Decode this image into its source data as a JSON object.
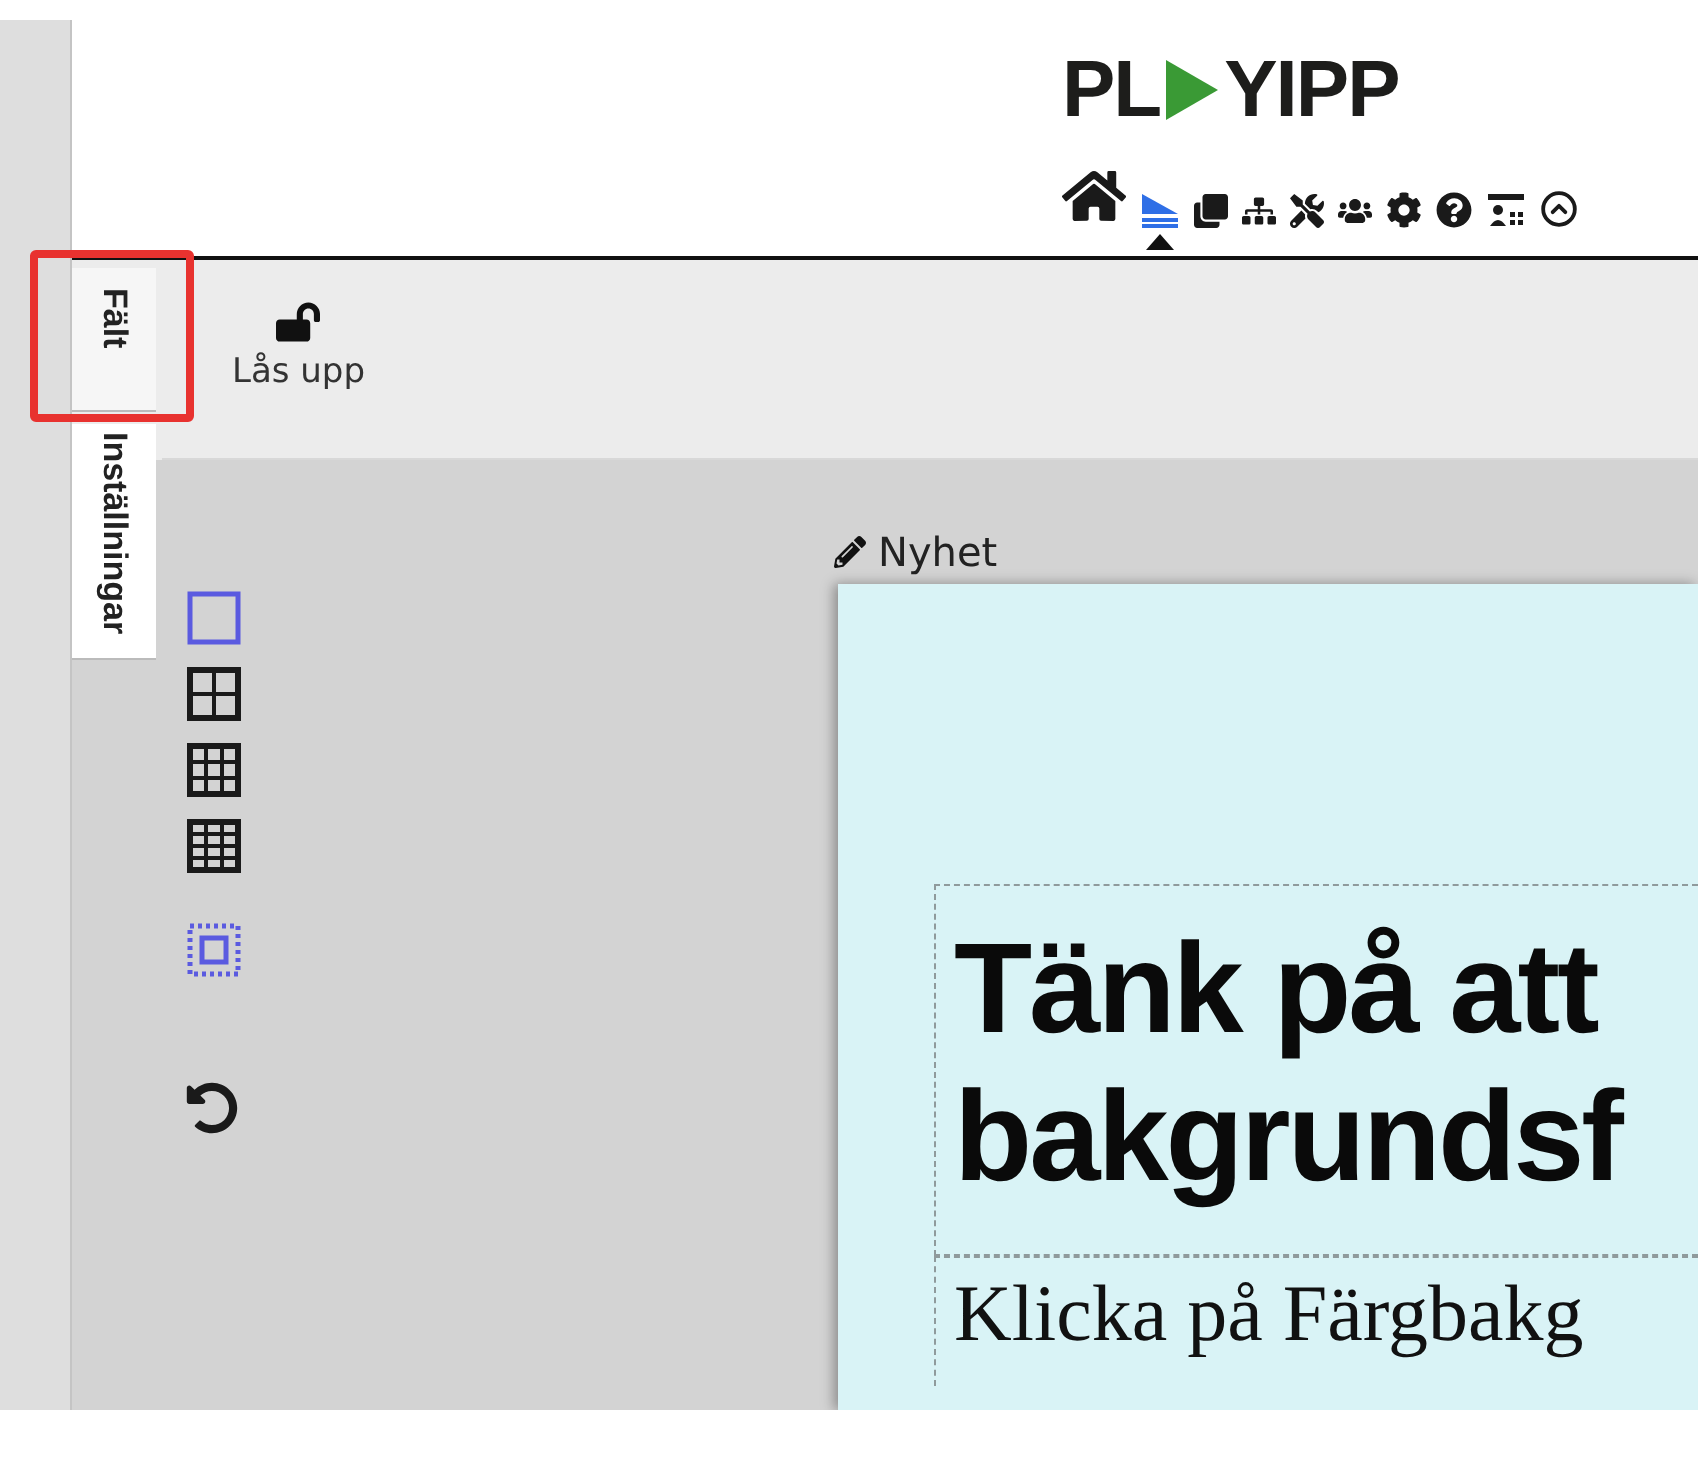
{
  "logo": {
    "left": "PL",
    "right": "YIPP"
  },
  "nav_items": [
    {
      "selected": false
    },
    {
      "selected": true
    },
    {
      "selected": false
    },
    {
      "selected": false
    },
    {
      "selected": false
    },
    {
      "selected": false
    },
    {
      "selected": false
    },
    {
      "selected": false
    },
    {
      "selected": false
    },
    {
      "selected": false
    }
  ],
  "side_tabs": [
    {
      "label": "Fält"
    },
    {
      "label": "Inställningar"
    }
  ],
  "toolbar": {
    "unlock_button": "Lås upp"
  },
  "layout_options": [
    {
      "selected": true
    },
    {
      "selected": false
    },
    {
      "selected": false
    },
    {
      "selected": false
    }
  ],
  "padding_toggle": {
    "on": true
  },
  "slide": {
    "label": "Nyhet",
    "heading": [
      "Tänk på att",
      "bakgrundsf"
    ],
    "body": "Klicka på Färgbakg"
  }
}
